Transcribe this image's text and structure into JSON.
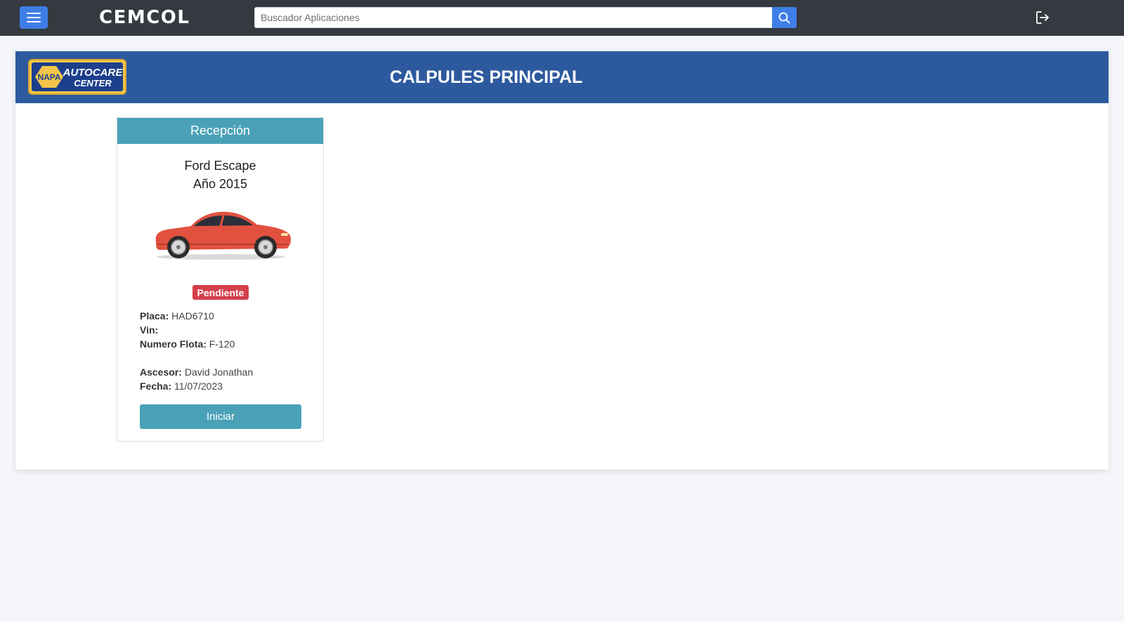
{
  "topbar": {
    "menu_icon": "hamburger-menu-icon",
    "brand": "CEMCOL",
    "search": {
      "placeholder": "Buscador Aplicaciones",
      "value": "",
      "icon": "search-icon"
    },
    "logout_icon": "logout-icon"
  },
  "panel": {
    "logo": {
      "line1": "NAPA",
      "line2": "AUTOCARE",
      "line3": "CENTER"
    },
    "title": "CALPULES PRINCIPAL"
  },
  "card": {
    "header": "Recepción",
    "car_model": "Ford Escape",
    "car_year": "Año 2015",
    "car_icon": "red-car-image",
    "status": "Pendiente",
    "fields": {
      "placa_label": "Placa:",
      "placa_value": "HAD6710",
      "vin_label": "Vin:",
      "vin_value": "",
      "flota_label": "Numero Flota:",
      "flota_value": "F-120",
      "ascesor_label": "Ascesor:",
      "ascesor_value": "David Jonathan",
      "fecha_label": "Fecha:",
      "fecha_value": "11/07/2023"
    },
    "button": "Iniciar"
  },
  "colors": {
    "topbar": "#343a40",
    "accent_blue": "#3f7ee8",
    "panel_header": "#2d5a9e",
    "card_header": "#4aa1b7",
    "badge": "#d43f4b"
  }
}
